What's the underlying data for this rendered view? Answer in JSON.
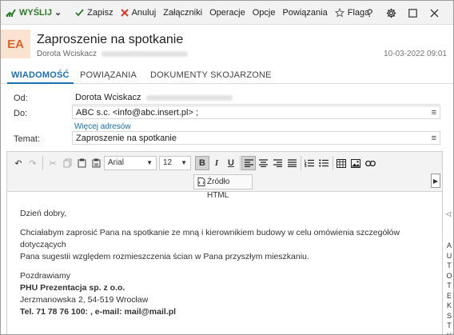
{
  "toolbar": {
    "send_label": "WYŚLIJ",
    "save_label": "Zapisz",
    "cancel_label": "Anuluj",
    "attachments_label": "Załączniki",
    "operations_label": "Operacje",
    "options_label": "Opcje",
    "links_label": "Powiązania",
    "flag_label": "Flaga",
    "icons": [
      "send-icon",
      "save-icon",
      "cancel-icon",
      "flag-icon",
      "help-icon",
      "gear-icon",
      "maximize-icon",
      "close-icon"
    ],
    "colors": {
      "send": "#2d7a2d",
      "cancel": "#d33a2c"
    }
  },
  "header": {
    "avatar_initials": "EA",
    "avatar_bg": "#fbe3d2",
    "avatar_fg": "#d9652b",
    "subject": "Zaproszenie na spotkanie",
    "sender_name": "Dorota Wciskacz",
    "date": "10-03-2022 09:01"
  },
  "tabs": [
    {
      "label": "WIADOMOŚĆ",
      "active": true
    },
    {
      "label": "POWIĄZANIA",
      "active": false
    },
    {
      "label": "DOKUMENTY SKOJARZONE",
      "active": false
    }
  ],
  "form": {
    "from_label": "Od:",
    "from_value": "Dorota Wciskacz",
    "to_label": "Do:",
    "to_value": "ABC s.c. <info@abc.insert.pl> ;",
    "more_addresses": "Więcej adresów",
    "subject_label": "Temat:",
    "subject_value": "Zaproszenie na spotkanie",
    "menu_icon": "≡"
  },
  "editor": {
    "font": "Arial",
    "size": "12",
    "source_label": "Źródło HTML",
    "bold_active": true,
    "align_left_active": true,
    "body": {
      "greeting": "Dzień dobry,",
      "para1": "Chciałabym zaprosić Pana na spotkanie ze mną i kierownikiem budowy w celu omówienia szczegółów dotyczących",
      "para2": "Pana sugestii względem rozmieszczenia ścian w Pana przyszłym mieszkaniu.",
      "closing": "Pozdrawiamy",
      "company": "PHU Prezentacja sp. z o.o.",
      "address": "Jerzmanowska 2, 54-519 Wrocław",
      "contact": "Tel. 71 78 76 100: , e-mail: mail@mail.pl"
    }
  },
  "side_panel": {
    "label": "AUTOTEKSTY",
    "arrow": "◁"
  }
}
